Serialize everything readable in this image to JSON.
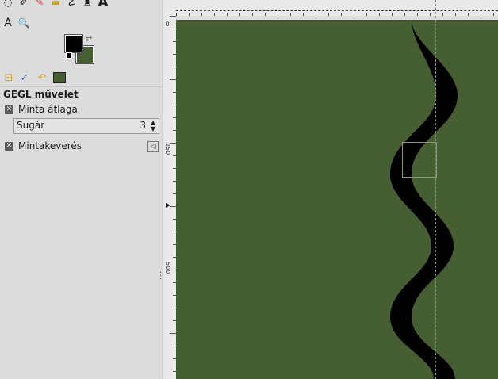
{
  "toolbox": {
    "row1": [
      {
        "icon": "lasso-icon",
        "glyph": "◌"
      },
      {
        "icon": "brush-icon",
        "glyph": "✐"
      },
      {
        "icon": "pencil-icon",
        "glyph": "✎"
      },
      {
        "icon": "eraser-icon",
        "glyph": "▬"
      },
      {
        "icon": "smudge-icon",
        "glyph": "☡"
      },
      {
        "icon": "ink-icon",
        "glyph": "♜"
      },
      {
        "icon": "text-tool-icon",
        "glyph": "A"
      }
    ],
    "row2": [
      {
        "icon": "measure-icon",
        "glyph": "A"
      },
      {
        "icon": "zoom-icon",
        "glyph": "🔍"
      }
    ],
    "foreground_color": "#000000",
    "background_color": "#455e32"
  },
  "tool_options": {
    "tabs": [
      "tool-options-tab",
      "device-status-tab",
      "undo-history-tab",
      "images-tab"
    ],
    "section_title": "GEGL művelet",
    "sample_average_label": "Minta átlaga",
    "radius_label": "Sugár",
    "radius_value": "3",
    "sample_merged_label": "Mintakeverés"
  },
  "rulers": {
    "left_labels": [
      "0",
      "250",
      "500"
    ]
  },
  "canvas": {
    "image_color": "#455e32",
    "stroke_color": "#000000",
    "guide_color": "#2fa7c9"
  }
}
